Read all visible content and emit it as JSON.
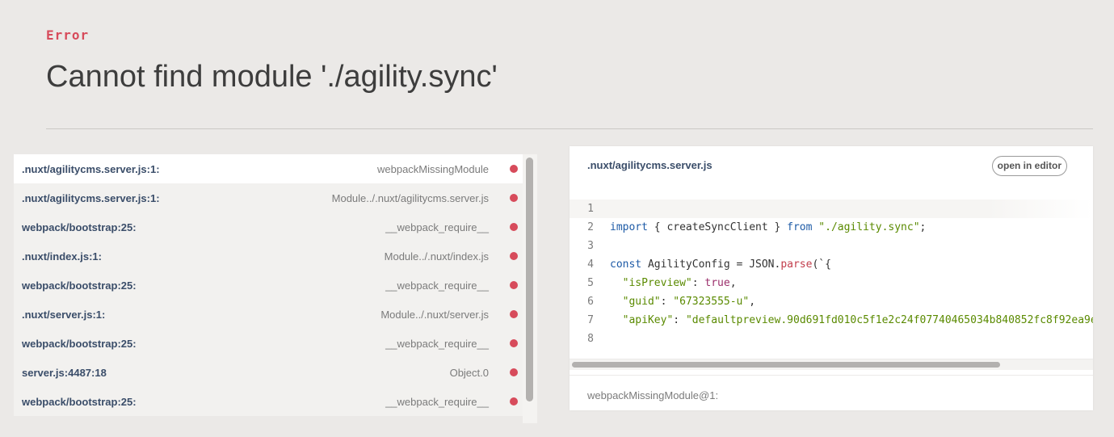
{
  "error": {
    "label": "Error",
    "message": "Cannot find module './agility.sync'"
  },
  "frames": [
    {
      "file": ".nuxt/agilitycms.server.js:1:",
      "fn": "webpackMissingModule",
      "active": true
    },
    {
      "file": ".nuxt/agilitycms.server.js:1:",
      "fn": "Module../.nuxt/agilitycms.server.js",
      "active": false
    },
    {
      "file": "webpack/bootstrap:25:",
      "fn": "__webpack_require__",
      "active": false
    },
    {
      "file": ".nuxt/index.js:1:",
      "fn": "Module../.nuxt/index.js",
      "active": false
    },
    {
      "file": "webpack/bootstrap:25:",
      "fn": "__webpack_require__",
      "active": false
    },
    {
      "file": ".nuxt/server.js:1:",
      "fn": "Module../.nuxt/server.js",
      "active": false
    },
    {
      "file": "webpack/bootstrap:25:",
      "fn": "__webpack_require__",
      "active": false
    },
    {
      "file": "server.js:4487:18",
      "fn": "Object.0",
      "active": false
    },
    {
      "file": "webpack/bootstrap:25:",
      "fn": "__webpack_require__",
      "active": false
    }
  ],
  "panel": {
    "file": ".nuxt/agilitycms.server.js",
    "open_button": "open in editor",
    "footer": "webpackMissingModule@1:",
    "code": [
      {
        "n": "1",
        "tokens": []
      },
      {
        "n": "2",
        "tokens": [
          {
            "t": "kw",
            "v": "import"
          },
          {
            "t": "def",
            "v": " { createSyncClient } "
          },
          {
            "t": "kw",
            "v": "from"
          },
          {
            "t": "def",
            "v": " "
          },
          {
            "t": "str",
            "v": "\"./agility.sync\""
          },
          {
            "t": "def",
            "v": ";"
          }
        ]
      },
      {
        "n": "3",
        "tokens": []
      },
      {
        "n": "4",
        "tokens": [
          {
            "t": "kw",
            "v": "const"
          },
          {
            "t": "def",
            "v": " AgilityConfig = JSON."
          },
          {
            "t": "fn",
            "v": "parse"
          },
          {
            "t": "def",
            "v": "(`{"
          }
        ]
      },
      {
        "n": "5",
        "tokens": [
          {
            "t": "def",
            "v": "  "
          },
          {
            "t": "str",
            "v": "\"isPreview\""
          },
          {
            "t": "def",
            "v": ": "
          },
          {
            "t": "bool",
            "v": "true"
          },
          {
            "t": "def",
            "v": ","
          }
        ]
      },
      {
        "n": "6",
        "tokens": [
          {
            "t": "def",
            "v": "  "
          },
          {
            "t": "str",
            "v": "\"guid\""
          },
          {
            "t": "def",
            "v": ": "
          },
          {
            "t": "str",
            "v": "\"67323555-u\""
          },
          {
            "t": "def",
            "v": ","
          }
        ]
      },
      {
        "n": "7",
        "tokens": [
          {
            "t": "def",
            "v": "  "
          },
          {
            "t": "str",
            "v": "\"apiKey\""
          },
          {
            "t": "def",
            "v": ": "
          },
          {
            "t": "str",
            "v": "\"defaultpreview.90d691fd010c5f1e2c24f07740465034b840852fc8f92ea9e"
          }
        ]
      },
      {
        "n": "8",
        "tokens": []
      }
    ]
  },
  "colors": {
    "accent": "#d74b5b",
    "background": "#ebe9e7",
    "keyword": "#1d5aa6",
    "string": "#5a8a00"
  }
}
